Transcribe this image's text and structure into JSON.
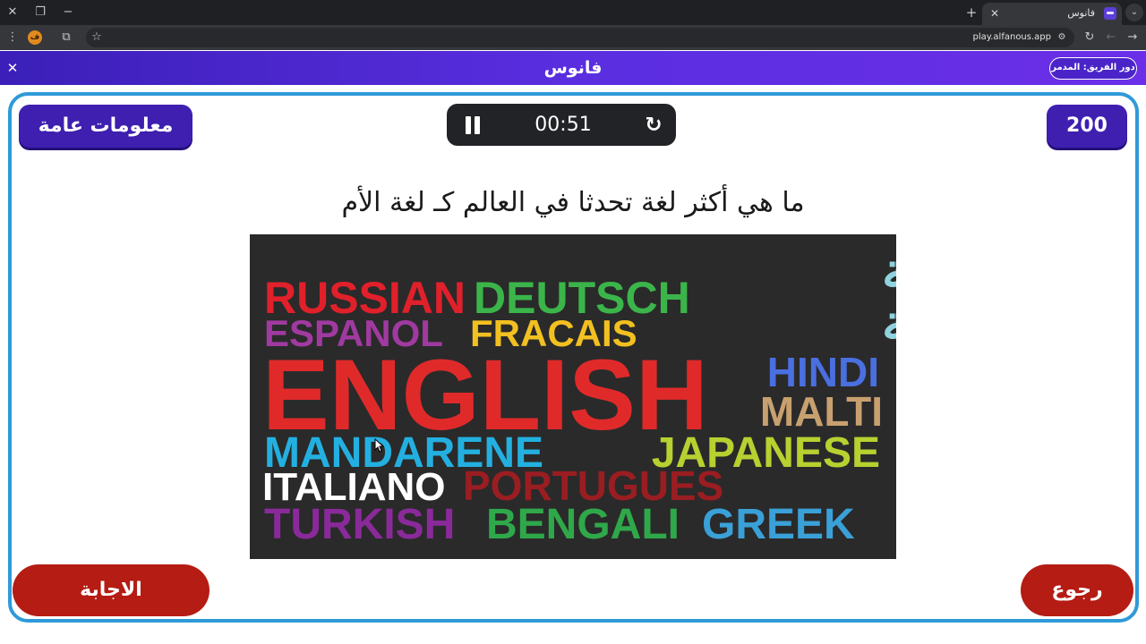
{
  "browser": {
    "tab_title": "فانوس",
    "url": "play.alfanous.app",
    "icons": [
      "close-icon",
      "restore-icon",
      "minimize-icon",
      "new-tab-icon",
      "tab-search-icon",
      "menu-icon",
      "extension-icon",
      "extensions-puzzle-icon",
      "bookmark-star-icon",
      "site-info-icon",
      "reload-icon",
      "back-icon",
      "forward-icon"
    ],
    "extension_badge": "ف"
  },
  "header": {
    "logo": "فانوس",
    "turn_label": "دور الفريق: المدمر"
  },
  "board": {
    "category": "معلومات عامة",
    "points": "200",
    "timer": "00:51",
    "question": "ما هي أكثر لغة تحدثا في العالم كـ لغة الأم",
    "answer_label": "الاجابة",
    "back_label": "رجوع"
  },
  "image_words": [
    {
      "text": "RUSSIAN",
      "color": "#e0202a"
    },
    {
      "text": "DEUTSCH",
      "color": "#3bb54a"
    },
    {
      "text": "اللغة",
      "color": "#8fd3df"
    },
    {
      "text": "العربية",
      "color": "#8fd3df"
    },
    {
      "text": "ESPANOL",
      "color": "#a03aa0"
    },
    {
      "text": "FRACAIS",
      "color": "#f2c020"
    },
    {
      "text": "ENGLISH",
      "color": "#e02a2a"
    },
    {
      "text": "HINDI",
      "color": "#4a6fe0"
    },
    {
      "text": "MALTI",
      "color": "#c8a070"
    },
    {
      "text": "MANDARENE",
      "color": "#23b0e0"
    },
    {
      "text": "JAPANESE",
      "color": "#b8d030"
    },
    {
      "text": "ITALIANO",
      "color": "#ffffff"
    },
    {
      "text": "PORTUGUES",
      "color": "#9a1d22"
    },
    {
      "text": "TURKISH",
      "color": "#8a2a9a"
    },
    {
      "text": "BENGALI",
      "color": "#2fa84a"
    },
    {
      "text": "GREEK",
      "color": "#3aa0d8"
    }
  ],
  "colors": {
    "header_start": "#3b1fb8",
    "header_end": "#6b2fe8",
    "board_border": "#2f9ad8",
    "primary_button": "#3e1fb0",
    "danger_button": "#b51c14",
    "timer_bg": "#222326"
  }
}
